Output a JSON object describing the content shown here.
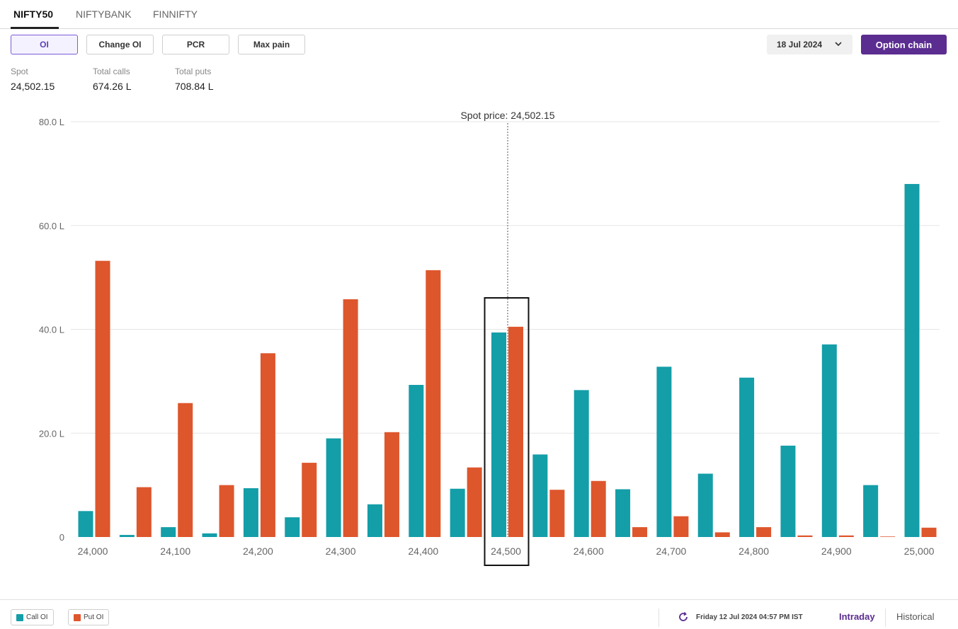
{
  "tabs": [
    {
      "label": "NIFTY50",
      "active": true
    },
    {
      "label": "NIFTYBANK",
      "active": false
    },
    {
      "label": "FINNIFTY",
      "active": false
    }
  ],
  "buttons": {
    "oi": "OI",
    "change_oi": "Change OI",
    "pcr": "PCR",
    "max_pain": "Max pain"
  },
  "expiry": {
    "selected": "18 Jul 2024"
  },
  "option_chain_label": "Option chain",
  "stats": {
    "spot_label": "Spot",
    "spot_value": "24,502.15",
    "calls_label": "Total calls",
    "calls_value": "674.26 L",
    "puts_label": "Total puts",
    "puts_value": "708.84 L"
  },
  "chart_data": {
    "type": "bar",
    "annotation": "Spot price: 24,502.15",
    "spot": 24502.15,
    "highlight_category": "24,500",
    "ylim": [
      0,
      80
    ],
    "yticks": [
      0,
      20,
      40,
      60,
      80
    ],
    "ytick_labels": [
      "0",
      "20.0 L",
      "40.0 L",
      "60.0 L",
      "80.0 L"
    ],
    "grid": true,
    "strikes": [
      24000,
      24050,
      24100,
      24150,
      24200,
      24250,
      24300,
      24350,
      24400,
      24450,
      24500,
      24550,
      24600,
      24650,
      24700,
      24750,
      24800,
      24850,
      24900,
      24950,
      25000
    ],
    "xtick_labels": [
      "24,000",
      "24,100",
      "24,200",
      "24,300",
      "24,400",
      "24,500",
      "24,600",
      "24,700",
      "24,800",
      "24,900",
      "25,000"
    ],
    "series": [
      {
        "name": "Call OI",
        "color": "#139ea8",
        "values": [
          5.0,
          0.4,
          1.9,
          0.7,
          9.4,
          3.8,
          19.0,
          6.3,
          29.3,
          9.3,
          39.4,
          15.9,
          28.3,
          9.2,
          32.8,
          12.2,
          30.7,
          17.6,
          37.1,
          10.0,
          68.0
        ]
      },
      {
        "name": "Put OI",
        "color": "#de562c",
        "values": [
          53.2,
          9.6,
          25.8,
          10.0,
          35.4,
          14.3,
          45.8,
          20.2,
          51.4,
          13.4,
          40.5,
          9.1,
          10.8,
          1.9,
          4.0,
          0.9,
          1.9,
          0.3,
          0.3,
          0.1,
          1.8
        ]
      }
    ]
  },
  "footer": {
    "legend_call": "Call OI",
    "legend_put": "Put OI",
    "call_color": "#139ea8",
    "put_color": "#de562c",
    "timestamp": "Friday 12 Jul 2024 04:57 PM IST",
    "intraday": "Intraday",
    "historical": "Historical"
  }
}
